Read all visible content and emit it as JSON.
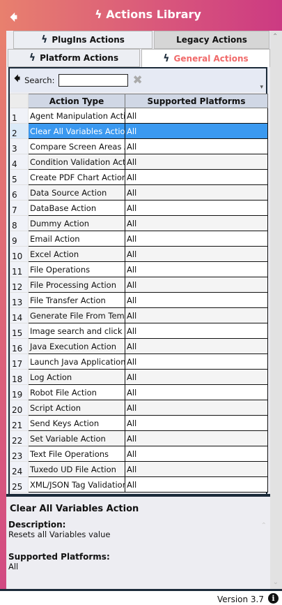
{
  "header": {
    "title": "Actions Library",
    "back_icon": "arrow-left-icon",
    "title_icon": "lightning-icon"
  },
  "tabs": [
    {
      "label": "PlugIns Actions",
      "icon": "lightning-plug-icon"
    },
    {
      "label": "Legacy Actions"
    },
    {
      "label": "Platform Actions",
      "icon": "lightning-platform-icon"
    },
    {
      "label": "General Actions",
      "icon": "lightning-general-icon",
      "active": true,
      "color": "#f06a6a"
    }
  ],
  "toolbar": {
    "search_label": "Search:",
    "search_value": "",
    "clear_icon": "close-x-icon"
  },
  "grid": {
    "columns": [
      "Action Type",
      "Supported Platforms"
    ],
    "selected_row": 2,
    "rows": [
      [
        "1",
        "Agent Manipulation Action",
        "All"
      ],
      [
        "2",
        "Clear All Variables Action",
        "All"
      ],
      [
        "3",
        "Compare Screen Areas Action",
        "All"
      ],
      [
        "4",
        "Condition Validation Action",
        "All"
      ],
      [
        "5",
        "Create PDF Chart Action",
        "All"
      ],
      [
        "6",
        "Data Source Action",
        "All"
      ],
      [
        "7",
        "DataBase Action",
        "All"
      ],
      [
        "8",
        "Dummy Action",
        "All"
      ],
      [
        "9",
        "Email Action",
        "All"
      ],
      [
        "10",
        "Excel Action",
        "All"
      ],
      [
        "11",
        "File Operations",
        "All"
      ],
      [
        "12",
        "File Processing Action",
        "All"
      ],
      [
        "13",
        "File Transfer Action",
        "All"
      ],
      [
        "14",
        "Generate File From Template",
        "All"
      ],
      [
        "15",
        "Image search and click on",
        "All"
      ],
      [
        "16",
        "Java Execution Action",
        "All"
      ],
      [
        "17",
        "Launch Java Application",
        "All"
      ],
      [
        "18",
        "Log Action",
        "All"
      ],
      [
        "19",
        "Robot File Action",
        "All"
      ],
      [
        "20",
        "Script Action",
        "All"
      ],
      [
        "21",
        "Send Keys Action",
        "All"
      ],
      [
        "22",
        "Set Variable Action",
        "All"
      ],
      [
        "23",
        "Text File Operations",
        "All"
      ],
      [
        "24",
        "Tuxedo UD File Action",
        "All"
      ],
      [
        "25",
        "XML/JSON Tag Validation",
        "All"
      ]
    ]
  },
  "details": {
    "title": "Clear All Variables Action",
    "description_label": "Description:",
    "description": "Resets all Variables value",
    "platforms_label": "Supported Platforms:",
    "platforms": "All"
  },
  "footer": {
    "version": "Version 3.7",
    "info_icon": "info-icon"
  },
  "colors": {
    "accent": "#cc3a82",
    "header_start": "#e8806e",
    "selection": "#3b99f0",
    "dark": "#1c2b3a"
  }
}
